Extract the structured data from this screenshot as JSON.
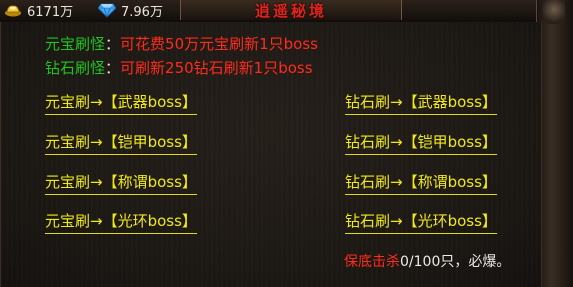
{
  "header": {
    "gold_value": "6171万",
    "diamond_value": "7.96万",
    "title": "逍遥秘境",
    "gold_icon": "gold-ingot-icon",
    "diamond_icon": "diamond-icon"
  },
  "info": {
    "yuanbao_label": "元宝刷怪",
    "yuanbao_desc": "可花费50万元宝刷新1只boss",
    "zuanshi_label": "钻石刷怪",
    "zuanshi_desc": "可刷新250钻石刷新1只boss",
    "colon": "："
  },
  "buttons": {
    "left": [
      "元宝刷→【武器boss】",
      "元宝刷→【铠甲boss】",
      "元宝刷→【称谓boss】",
      "元宝刷→【光环boss】"
    ],
    "right": [
      "钻石刷→【武器boss】",
      "钻石刷→【铠甲boss】",
      "钻石刷→【称谓boss】",
      "钻石刷→【光环boss】"
    ]
  },
  "footer": {
    "label": "保底击杀",
    "progress": "0/100只，必爆。"
  },
  "colors": {
    "label_green": "#22c31f",
    "value_red": "#ff2b1c",
    "button_yellow": "#f0e91a",
    "title_red": "#e2231a"
  }
}
